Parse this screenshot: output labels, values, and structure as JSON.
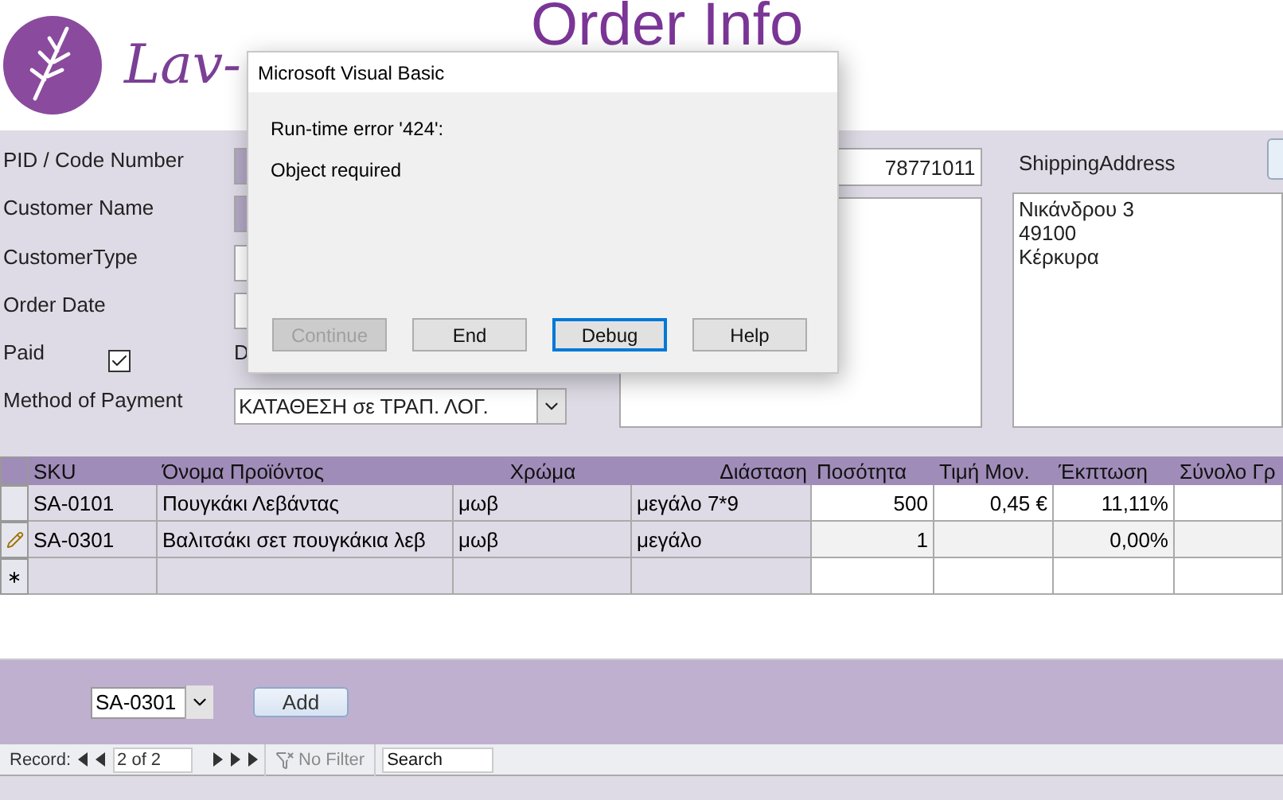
{
  "header": {
    "logo_text": "Lav-",
    "title": "Order Info"
  },
  "form": {
    "fields": [
      {
        "label": "PID / Code Number",
        "kind": "locked"
      },
      {
        "label": "Customer Name",
        "kind": "locked"
      },
      {
        "label": "CustomerType",
        "kind": "text"
      },
      {
        "label": "Order Date",
        "kind": "text"
      },
      {
        "label": "Paid",
        "kind": "check",
        "checked": true,
        "side_label": "D"
      },
      {
        "label": "Method of Payment",
        "kind": "combo",
        "value": "ΚΑΤΑΘΕΣΗ σε ΤΡΑΠ. ΛΟΓ."
      }
    ],
    "phone_value": "78771011",
    "shipping_label": "ShippingAddress",
    "shipping_address": [
      "Νικάνδρου 3",
      "49100",
      "Κέρκυρα"
    ]
  },
  "grid": {
    "columns": [
      "SKU",
      "Όνομα Προϊόντος",
      "Χρώμα",
      "Διάσταση",
      "Ποσότητα",
      "Τιμή Μον.",
      "Έκπτωση",
      "Σύνολο Γρ"
    ],
    "rows": [
      {
        "kind": "record",
        "cells": [
          "SA-0101",
          "Πουγκάκι Λεβάντας",
          "μωβ",
          "μεγάλο 7*9",
          "500",
          "0,45 €",
          "11,11%"
        ]
      },
      {
        "kind": "editing",
        "cells": [
          "SA-0301",
          "Βαλιτσάκι σετ πουγκάκια λεβ",
          "μωβ",
          "μεγάλο",
          "1",
          null,
          "0,00%"
        ]
      },
      {
        "kind": "new",
        "cells": []
      }
    ]
  },
  "footer": {
    "combo_value": "SA-0301",
    "add_button": "Add"
  },
  "navigation": {
    "label": "Record:",
    "position": "2 of 2",
    "filter": "No Filter",
    "filter_disabled": true,
    "search_placeholder": "Search"
  },
  "dialog": {
    "title": "Microsoft Visual Basic",
    "error": "Run-time error '424':",
    "message": "Object required",
    "buttons": [
      {
        "label": "Continue",
        "disabled": true,
        "focused": false
      },
      {
        "label": "End",
        "disabled": false,
        "focused": false
      },
      {
        "label": "Debug",
        "disabled": false,
        "focused": true
      },
      {
        "label": "Help",
        "disabled": false,
        "focused": false
      }
    ]
  }
}
